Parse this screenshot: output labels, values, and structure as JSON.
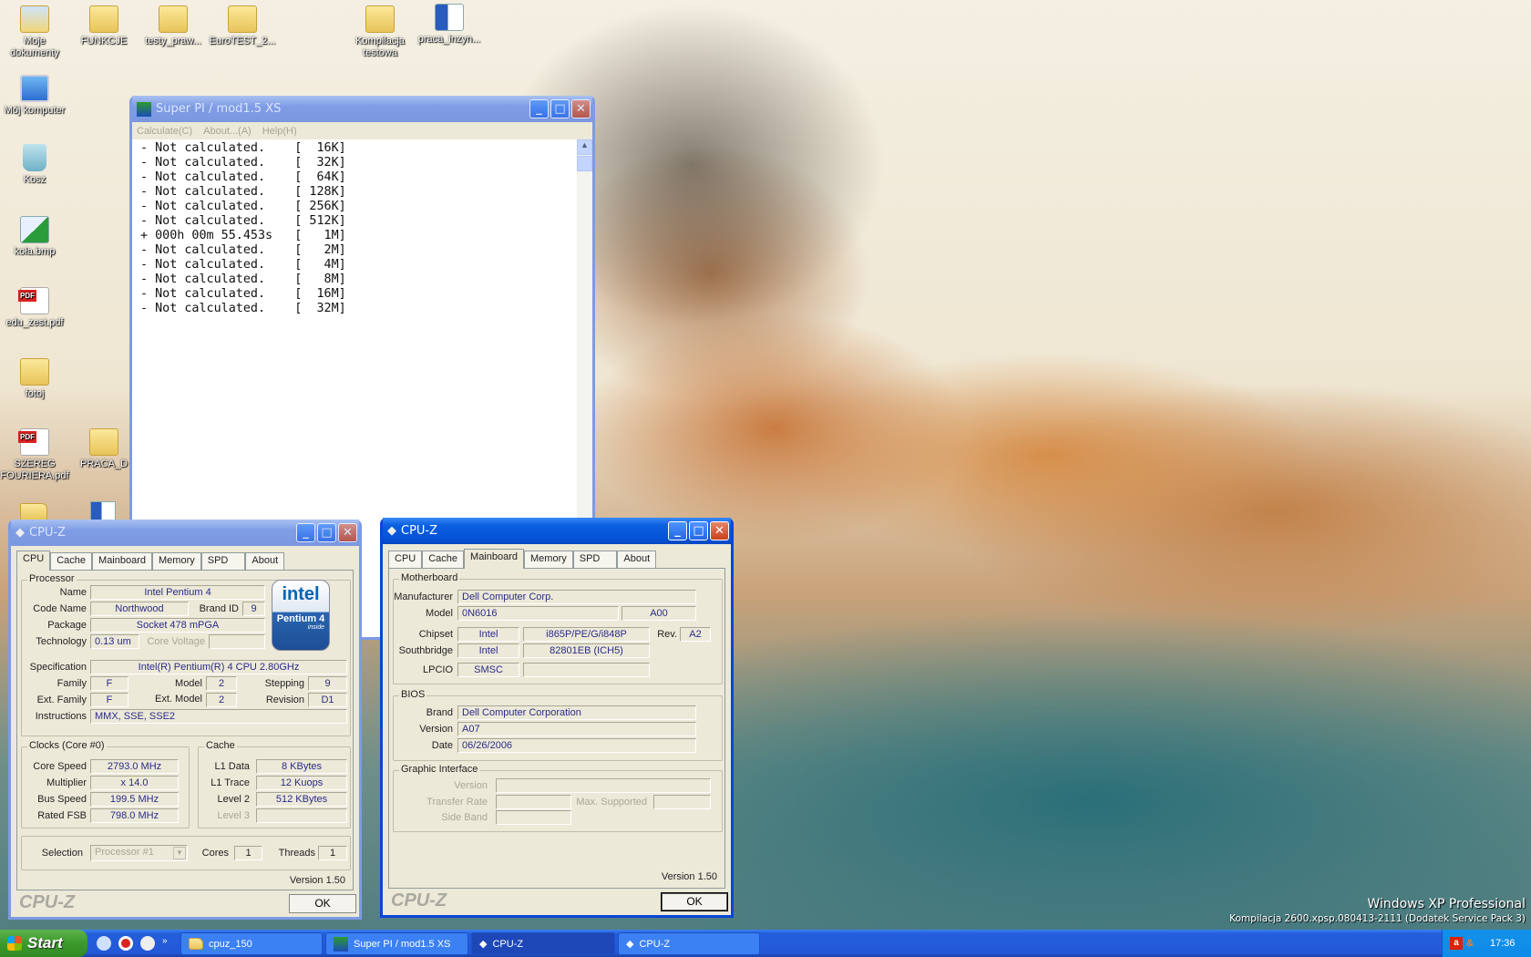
{
  "desktop": {
    "icons": [
      {
        "label": "Moje dokumenty",
        "type": "mydocs"
      },
      {
        "label": "FUNKCJE",
        "type": "folder"
      },
      {
        "label": "testy_praw...",
        "type": "folder"
      },
      {
        "label": "EuroTEST_2...",
        "type": "folder"
      },
      {
        "label": "Kompilacja testowa",
        "type": "folder"
      },
      {
        "label": "praca_inzyn...",
        "type": "word"
      },
      {
        "label": "Mój komputer",
        "type": "computer"
      },
      {
        "label": "Kosz",
        "type": "recycle"
      },
      {
        "label": "koła.bmp",
        "type": "bitmap"
      },
      {
        "label": "edu_zest.pdf",
        "type": "pdf"
      },
      {
        "label": "fotoj",
        "type": "folder"
      },
      {
        "label": "SZEREG FOURIERA.pdf",
        "type": "pdf"
      },
      {
        "label": "PRACA_D",
        "type": "folder"
      }
    ],
    "watermark": {
      "line1": "Windows XP Professional",
      "line2": "Kompilacja 2600.xpsp.080413-2111 (Dodatek Service Pack 3)"
    }
  },
  "superpi": {
    "title": "Super PI / mod1.5 XS",
    "menu": [
      "Calculate(C)",
      "About...(A)",
      "Help(H)"
    ],
    "lines": [
      "- Not calculated.    [  16K]",
      "- Not calculated.    [  32K]",
      "- Not calculated.    [  64K]",
      "- Not calculated.    [ 128K]",
      "- Not calculated.    [ 256K]",
      "- Not calculated.    [ 512K]",
      "+ 000h 00m 55.453s   [   1M]",
      "- Not calculated.    [   2M]",
      "- Not calculated.    [   4M]",
      "- Not calculated.    [   8M]",
      "- Not calculated.    [  16M]",
      "- Not calculated.    [  32M]"
    ]
  },
  "cpuz_tabs": [
    "CPU",
    "Cache",
    "Mainboard",
    "Memory",
    "SPD",
    "About"
  ],
  "cpuz_cpu": {
    "title": "CPU-Z",
    "processor_label": "Processor",
    "name_label": "Name",
    "name": "Intel Pentium 4",
    "codename_label": "Code Name",
    "codename": "Northwood",
    "brandid_label": "Brand ID",
    "brandid": "9",
    "package_label": "Package",
    "package": "Socket 478 mPGA",
    "tech_label": "Technology",
    "tech": "0.13 um",
    "voltage_label": "Core Voltage",
    "logo": {
      "brand": "intel",
      "product": "Pentium 4",
      "tag": "inside"
    },
    "spec_label": "Specification",
    "spec": "Intel(R) Pentium(R) 4 CPU 2.80GHz",
    "family_label": "Family",
    "family": "F",
    "model_label": "Model",
    "model": "2",
    "stepping_label": "Stepping",
    "stepping": "9",
    "extfamily_label": "Ext. Family",
    "extfamily": "F",
    "extmodel_label": "Ext. Model",
    "extmodel": "2",
    "revision_label": "Revision",
    "revision": "D1",
    "instr_label": "Instructions",
    "instr": "MMX, SSE, SSE2",
    "clocks_label": "Clocks (Core #0)",
    "corespeed_label": "Core Speed",
    "corespeed": "2793.0 MHz",
    "mult_label": "Multiplier",
    "mult": "x 14.0",
    "bus_label": "Bus Speed",
    "bus": "199.5 MHz",
    "fsb_label": "Rated FSB",
    "fsb": "798.0 MHz",
    "cache_label": "Cache",
    "l1d_label": "L1 Data",
    "l1d": "8 KBytes",
    "l1t_label": "L1 Trace",
    "l1t": "12 Kuops",
    "l2_label": "Level 2",
    "l2": "512 KBytes",
    "l3_label": "Level 3",
    "selection_label": "Selection",
    "selection": "Processor #1",
    "cores_label": "Cores",
    "cores": "1",
    "threads_label": "Threads",
    "threads": "1",
    "version": "Version 1.50",
    "brand": "CPU-Z",
    "ok": "OK"
  },
  "cpuz_mb": {
    "title": "CPU-Z",
    "mb_label": "Motherboard",
    "manuf_label": "Manufacturer",
    "manuf": "Dell Computer Corp.",
    "model_label": "Model",
    "model": "0N6016",
    "model_rev": "A00",
    "chipset_label": "Chipset",
    "chipset_vendor": "Intel",
    "chipset": "i865P/PE/G/i848P",
    "rev_label": "Rev.",
    "rev": "A2",
    "sb_label": "Southbridge",
    "sb_vendor": "Intel",
    "sb": "82801EB (ICH5)",
    "lpcio_label": "LPCIO",
    "lpcio": "SMSC",
    "bios_label": "BIOS",
    "brand_label": "Brand",
    "brand_val": "Dell Computer Corporation",
    "version_label": "Version",
    "version_val": "A07",
    "date_label": "Date",
    "date": "06/26/2006",
    "gi_label": "Graphic Interface",
    "gi_version_label": "Version",
    "gi_rate_label": "Transfer Rate",
    "gi_max_label": "Max. Supported",
    "gi_side_label": "Side Band",
    "version": "Version 1.50",
    "brand": "CPU-Z",
    "ok": "OK"
  },
  "taskbar": {
    "start": "Start",
    "buttons": [
      "cpuz_150",
      "Super PI / mod1.5 XS",
      "CPU-Z",
      "CPU-Z"
    ],
    "clock": "17:36"
  }
}
